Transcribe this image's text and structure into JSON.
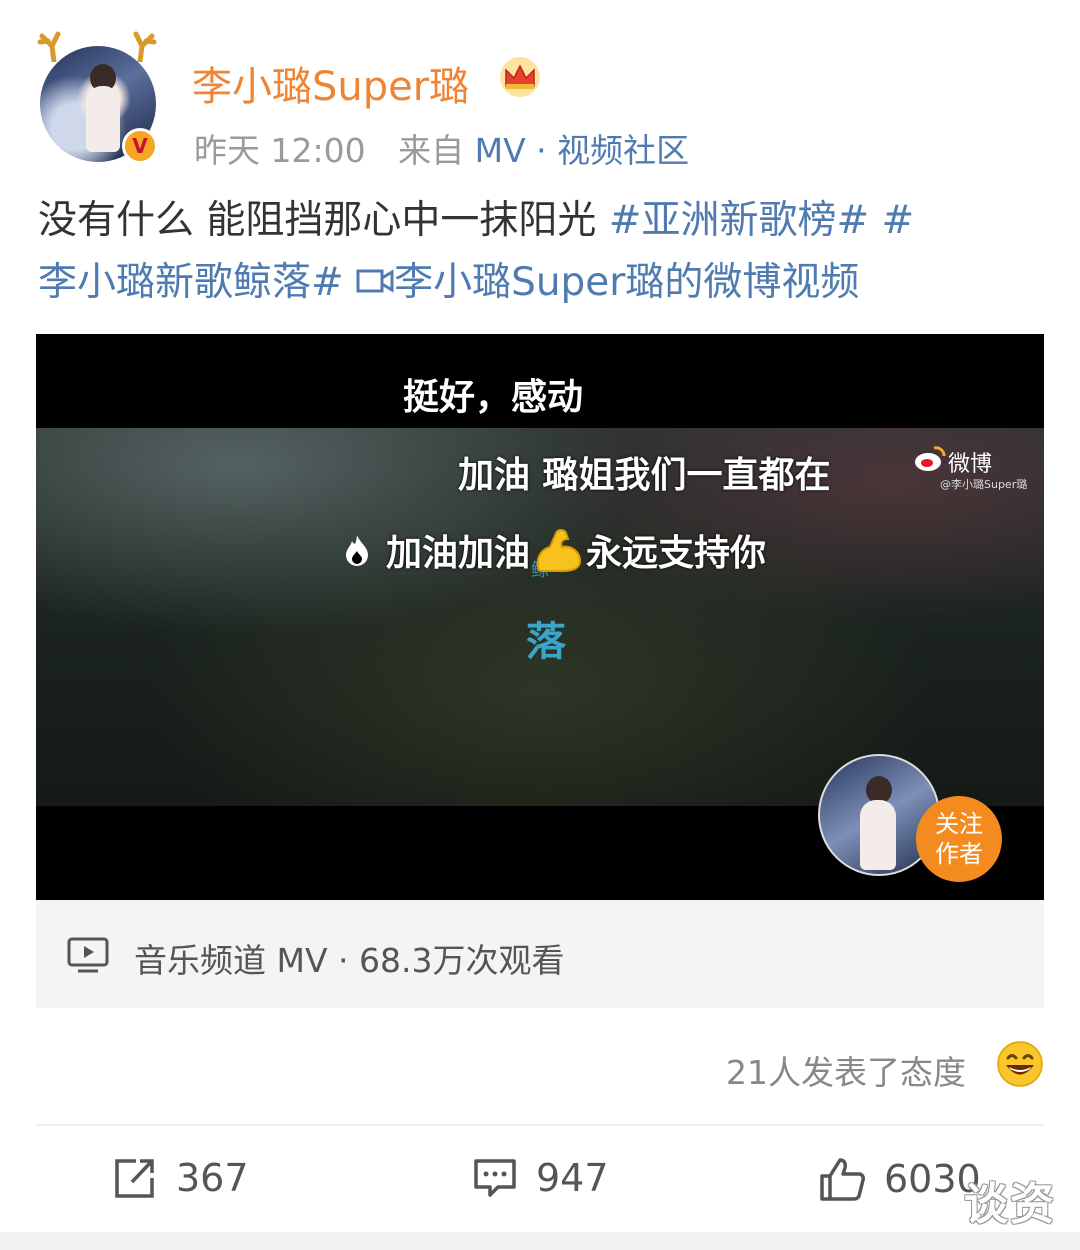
{
  "post": {
    "username": "李小璐Super璐",
    "time": "昨天 12:00",
    "source_prefix": "来自",
    "source_link": "MV · 视频社区",
    "text": "没有什么 能阻挡那心中一抹阳光 ",
    "tag1": "#亚洲新歌榜# #",
    "tag2": "李小璐新歌鲸落# ",
    "video_link": "李小璐Super璐的微博视频"
  },
  "video": {
    "danmu": [
      "挺好，感动",
      "加油  璐姐我们一直都在",
      "加油加油",
      "永远支持你"
    ],
    "logo_title": "落",
    "logo_sub": "鲸",
    "watermark": "微博",
    "watermark_handle": "@李小璐Super璐",
    "follow_label": "关注作者"
  },
  "source_bar": {
    "text": "音乐频道 MV · 68.3万次观看"
  },
  "reactions": {
    "text": "21人发表了态度"
  },
  "actions": {
    "share_count": "367",
    "comment_count": "947",
    "like_count": "6030"
  },
  "watermark_text": "谈资",
  "colors": {
    "username": "#f08432",
    "link": "#4f7bb0",
    "follow": "#f48b1f"
  }
}
